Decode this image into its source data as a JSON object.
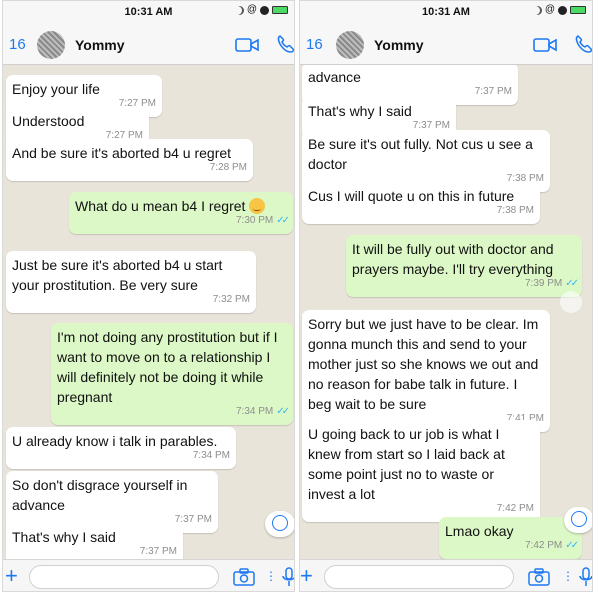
{
  "left": {
    "status": {
      "time": "10:31 AM"
    },
    "header": {
      "back_count": "16",
      "contact": "Yommy"
    },
    "messages": [
      {
        "text": "Enjoy your life",
        "time": "7:27 PM",
        "dir": "in"
      },
      {
        "text": "Understood",
        "time": "7:27 PM",
        "dir": "in"
      },
      {
        "text": "And be sure it's aborted b4 u regret",
        "time": "7:28 PM",
        "dir": "in"
      },
      {
        "text": "What do u mean b4 I regret",
        "time": "7:30 PM",
        "dir": "out",
        "emoji": "relieved-face"
      },
      {
        "text": "Just be sure it's aborted b4 u start your prostitution. Be very sure",
        "time": "7:32 PM",
        "dir": "in"
      },
      {
        "text": "I'm not doing any prostitution but if I want to move on to a relationship I will definitely not be doing it while pregnant",
        "time": "7:34 PM",
        "dir": "out"
      },
      {
        "text": "U already know i talk in parables.",
        "time": "7:34 PM",
        "dir": "in"
      },
      {
        "text": "So  don't disgrace yourself in advance",
        "time": "7:37 PM",
        "dir": "in"
      },
      {
        "text": "That's why I said",
        "time": "7:37 PM",
        "dir": "in"
      }
    ]
  },
  "right": {
    "status": {
      "time": "10:31 AM"
    },
    "header": {
      "back_count": "16",
      "contact": "Yommy"
    },
    "messages": [
      {
        "text": "advance",
        "time": "7:37 PM",
        "dir": "in"
      },
      {
        "text": "That's why I said",
        "time": "7:37 PM",
        "dir": "in"
      },
      {
        "text": "Be sure it's out fully. Not cus u see a doctor",
        "time": "7:38 PM",
        "dir": "in"
      },
      {
        "text": "Cus I will quote u on this in future",
        "time": "7:38 PM",
        "dir": "in"
      },
      {
        "text": "It will be fully out with doctor and prayers maybe. I'll try everything",
        "time": "7:39 PM",
        "dir": "out"
      },
      {
        "text": "Sorry but we just have to be clear. Im gonna munch this and send to your mother just so she knows we out and no reason for babe talk in future. I beg wait to be sure",
        "time": "7:41 PM",
        "dir": "in"
      },
      {
        "text": "U going back to ur job is what I knew from start so I laid back at some point just no to waste or invest a lot",
        "time": "7:42 PM",
        "dir": "in"
      },
      {
        "text": "Lmao okay",
        "time": "7:42 PM",
        "dir": "out"
      }
    ]
  },
  "colors": {
    "incoming_bubble": "#ffffff",
    "outgoing_bubble": "#dcf8c6",
    "chat_background": "#e9e4da",
    "accent": "#1d79f2",
    "read_ticks": "#34b7f1"
  },
  "icons": {
    "video": "video-camera-icon",
    "call": "phone-icon",
    "attach": "plus-icon",
    "camera": "camera-icon",
    "mic": "microphone-icon",
    "scroll": "scroll-down-icon"
  }
}
